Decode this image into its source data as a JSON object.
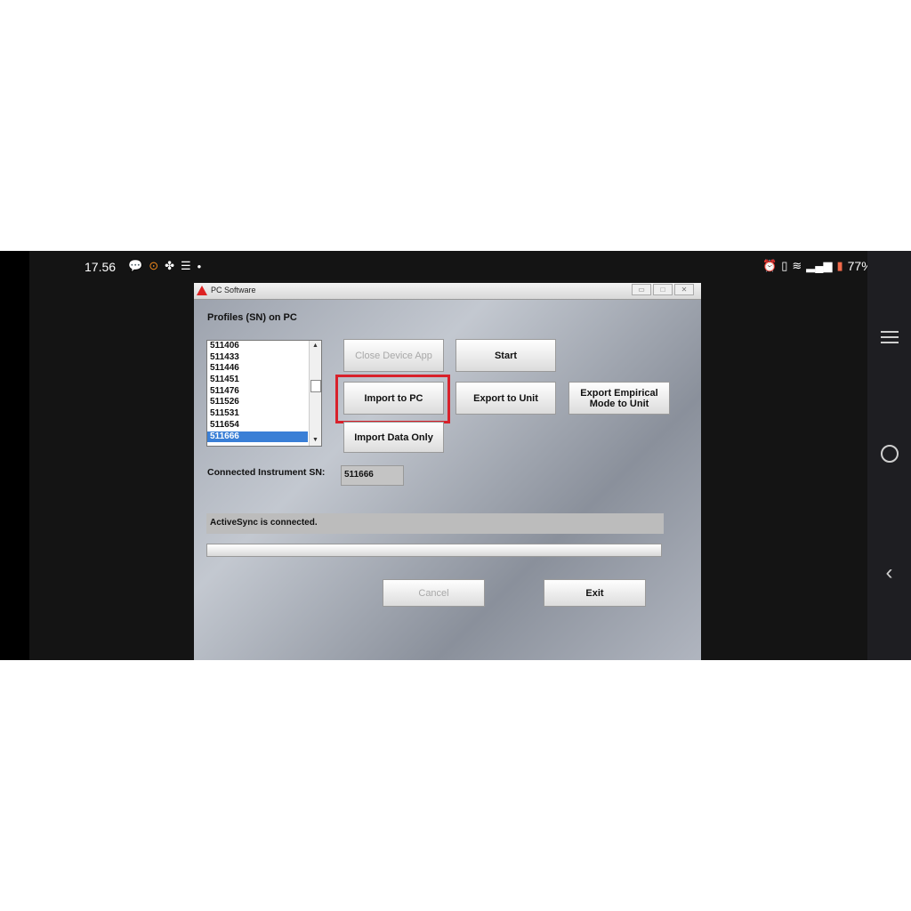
{
  "phone_status": {
    "time": "17.56",
    "battery": "77%"
  },
  "window": {
    "title": "PC Software",
    "profiles_label": "Profiles (SN) on PC",
    "profiles": [
      "511406",
      "511433",
      "511446",
      "511451",
      "511476",
      "511526",
      "511531",
      "511654",
      "511666"
    ],
    "selected_profile": "511666",
    "buttons": {
      "close_device_app": "Close Device App",
      "start": "Start",
      "import_to_pc": "Import to PC",
      "export_to_unit": "Export to Unit",
      "export_empirical_line1": "Export Empirical",
      "export_empirical_line2": "Mode to Unit",
      "import_data_only": "Import Data Only",
      "cancel": "Cancel",
      "exit": "Exit"
    },
    "connected_sn_label": "Connected Instrument SN:",
    "connected_sn_value": "511666",
    "status_text": "ActiveSync is connected.",
    "progress": 0
  },
  "colors": {
    "highlight": "#d8212b",
    "selection": "#3a7fd6"
  }
}
